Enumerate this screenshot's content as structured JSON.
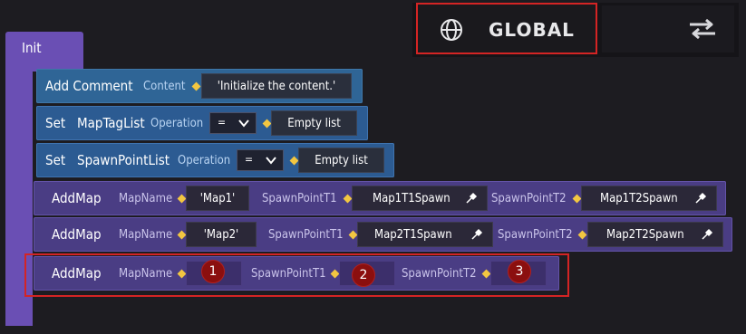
{
  "scope": {
    "label": "GLOBAL",
    "icon": "globe-icon",
    "toggle_icon": "swap-arrows-icon"
  },
  "event": {
    "label": "Init"
  },
  "rows": {
    "comment": {
      "keyword": "Add Comment",
      "param": "Content",
      "value": "'Initialize the content.'"
    },
    "set1": {
      "keyword": "Set",
      "target": "MapTagList",
      "param": "Operation",
      "operator": "=",
      "value": "Empty list"
    },
    "set2": {
      "keyword": "Set",
      "target": "SpawnPointList",
      "param": "Operation",
      "operator": "=",
      "value": "Empty list"
    },
    "map1": {
      "keyword": "AddMap",
      "p1": "MapName",
      "v1": "'Map1'",
      "p2": "SpawnPointT1",
      "v2": "Map1T1Spawn",
      "p3": "SpawnPointT2",
      "v3": "Map1T2Spawn"
    },
    "map2": {
      "keyword": "AddMap",
      "p1": "MapName",
      "v1": "'Map2'",
      "p2": "SpawnPointT1",
      "v2": "Map2T1Spawn",
      "p3": "SpawnPointT2",
      "v3": "Map2T2Spawn"
    },
    "map3": {
      "keyword": "AddMap",
      "p1": "MapName",
      "p2": "SpawnPointT1",
      "p3": "SpawnPointT2",
      "badge1": "1",
      "badge2": "2",
      "badge3": "3"
    }
  },
  "colors": {
    "event_block": "#6a4fb4",
    "statement_blue": "#2c5b92",
    "statement_purple": "#4a3d84",
    "connector": "#f2c641",
    "highlight": "#d42424"
  }
}
